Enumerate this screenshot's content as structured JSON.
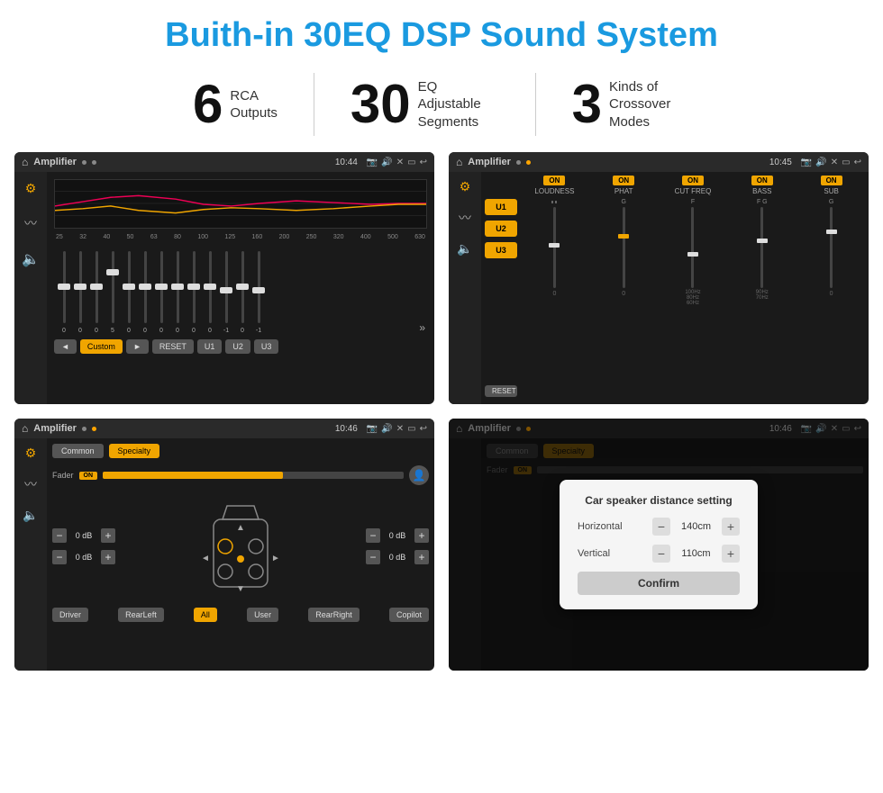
{
  "header": {
    "title": "Buith-in 30EQ DSP Sound System"
  },
  "stats": [
    {
      "number": "6",
      "text": "RCA\nOutputs"
    },
    {
      "number": "30",
      "text": "EQ Adjustable\nSegments"
    },
    {
      "number": "3",
      "text": "Kinds of\nCrossover Modes"
    }
  ],
  "screens": {
    "s1": {
      "title": "Amplifier",
      "time": "10:44",
      "freq_labels": [
        "25",
        "32",
        "40",
        "50",
        "63",
        "80",
        "100",
        "125",
        "160",
        "200",
        "250",
        "320",
        "400",
        "500",
        "630"
      ],
      "slider_values": [
        "0",
        "0",
        "0",
        "5",
        "0",
        "0",
        "0",
        "0",
        "0",
        "0",
        "-1",
        "0",
        "-1"
      ],
      "buttons": [
        "Custom",
        "RESET",
        "U1",
        "U2",
        "U3"
      ]
    },
    "s2": {
      "title": "Amplifier",
      "time": "10:45",
      "presets": [
        "U1",
        "U2",
        "U3"
      ],
      "channels": [
        "LOUDNESS",
        "PHAT",
        "CUT FREQ",
        "BASS",
        "SUB"
      ],
      "reset_label": "RESET"
    },
    "s3": {
      "title": "Amplifier",
      "time": "10:46",
      "tabs": [
        "Common",
        "Specialty"
      ],
      "fader_label": "Fader",
      "db_values": [
        "0 dB",
        "0 dB",
        "0 dB",
        "0 dB"
      ],
      "position_labels": [
        "Driver",
        "Copilot",
        "RearLeft",
        "All",
        "User",
        "RearRight"
      ]
    },
    "s4": {
      "title": "Amplifier",
      "time": "10:46",
      "dialog": {
        "title": "Car speaker distance setting",
        "rows": [
          {
            "label": "Horizontal",
            "value": "140cm"
          },
          {
            "label": "Vertical",
            "value": "110cm"
          }
        ],
        "confirm_label": "Confirm"
      }
    }
  }
}
